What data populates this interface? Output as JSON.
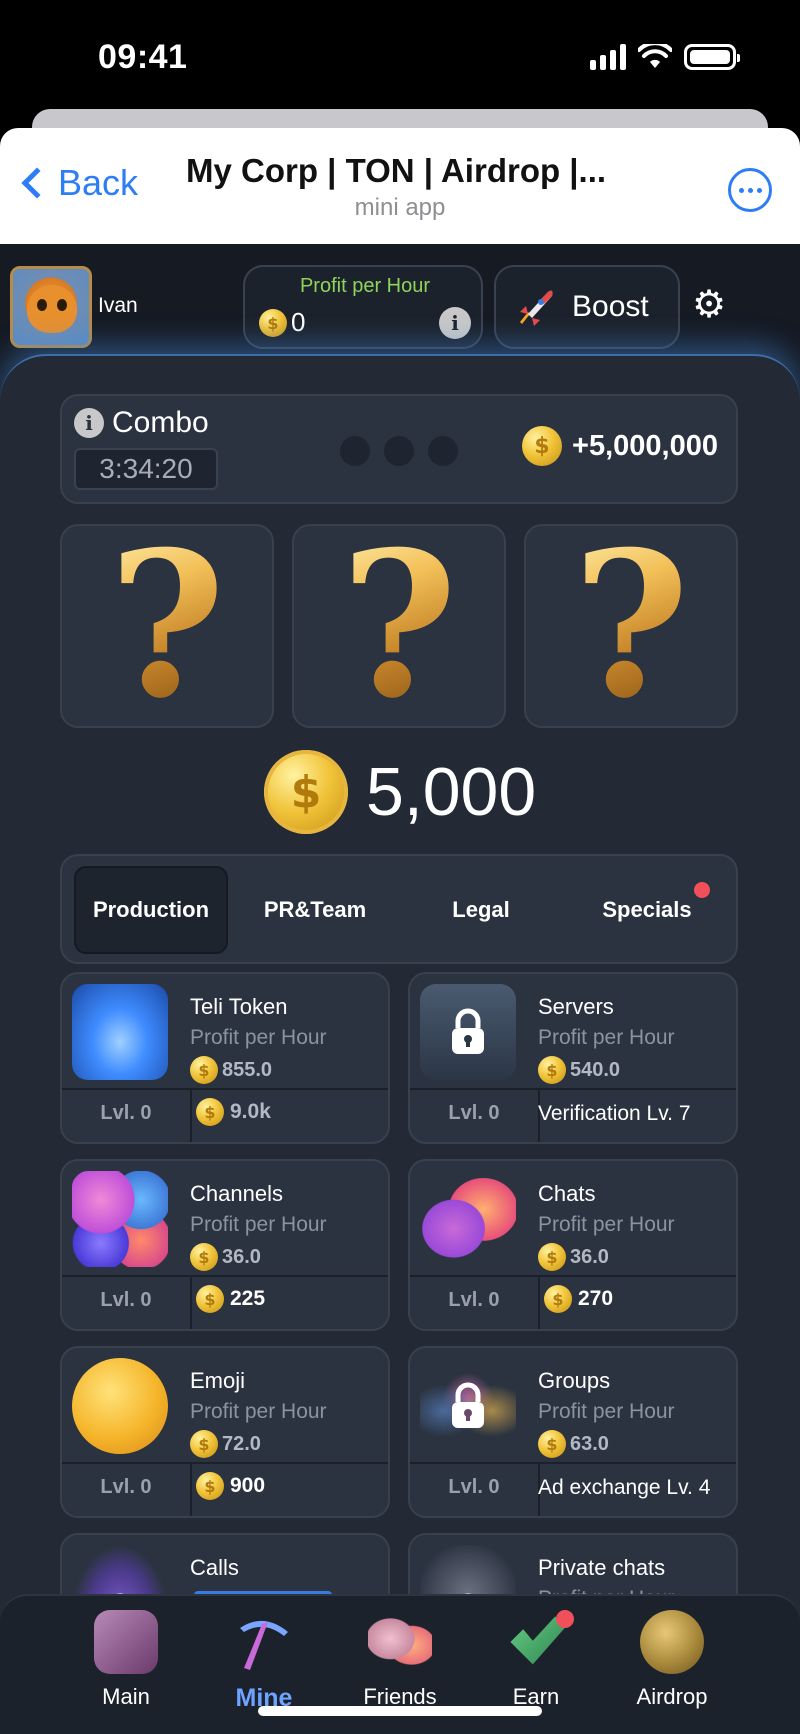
{
  "status_bar": {
    "time": "09:41"
  },
  "header": {
    "back_label": "Back",
    "title": "My Corp | TON | Airdrop |...",
    "subtitle": "mini app"
  },
  "user": {
    "name": "Ivan"
  },
  "profit": {
    "label": "Profit per Hour",
    "value": "0",
    "info": "i"
  },
  "boost": {
    "label": "Boost"
  },
  "combo": {
    "title": "Combo",
    "info": "i",
    "timer": "3:34:20",
    "reward": "+5,000,000"
  },
  "mystery_cards": [
    "?",
    "?",
    "?"
  ],
  "balance": {
    "value": "5,000"
  },
  "tabs": [
    {
      "label": "Production",
      "active": true
    },
    {
      "label": "PR&Team"
    },
    {
      "label": "Legal"
    },
    {
      "label": "Specials",
      "badge": true
    }
  ],
  "items": [
    {
      "name": "Teli Token",
      "sub": "Profit per Hour",
      "profit": "855.0",
      "level": "Lvl. 0",
      "cost": "9.0k",
      "icon": "token-stack-icon",
      "color": "#3f8cff"
    },
    {
      "name": "Servers",
      "sub": "Profit per Hour",
      "profit": "540.0",
      "level": "Lvl. 0",
      "requirement": "Verification Lv. 7",
      "icon": "lock-icon",
      "color": "#3a4456"
    },
    {
      "name": "Channels",
      "sub": "Profit per Hour",
      "profit": "36.0",
      "level": "Lvl. 0",
      "cost": "225",
      "icon": "megaphone-icon",
      "color": "#c04fd8"
    },
    {
      "name": "Chats",
      "sub": "Profit per Hour",
      "profit": "36.0",
      "level": "Lvl. 0",
      "cost": "270",
      "icon": "chat-bubbles-icon",
      "color": "#e06890"
    },
    {
      "name": "Emoji",
      "sub": "Profit per Hour",
      "profit": "72.0",
      "level": "Lvl. 0",
      "cost": "900",
      "icon": "emoji-icon",
      "color": "#f5b52a"
    },
    {
      "name": "Groups",
      "sub": "Profit per Hour",
      "profit": "63.0",
      "level": "Lvl. 0",
      "requirement": "Ad exchange Lv. 4",
      "icon": "lock-icon",
      "color": "#4b5a6e"
    },
    {
      "name": "Calls",
      "icon": "lock-icon",
      "color": "#5a4a8a"
    },
    {
      "name": "Private chats",
      "sub": "Profit per Hour",
      "icon": "lock-icon",
      "color": "#4a5060"
    }
  ],
  "bottom_nav": [
    {
      "label": "Main",
      "icon": "cube-icon",
      "color": "#8a5a8a"
    },
    {
      "label": "Mine",
      "icon": "pickaxe-icon",
      "color": "#5a7ad8",
      "active": true
    },
    {
      "label": "Friends",
      "icon": "ghosts-icon",
      "color": "#d88a9a"
    },
    {
      "label": "Earn",
      "icon": "check-icon",
      "color": "#3a9a5a",
      "badge": true
    },
    {
      "label": "Airdrop",
      "icon": "coin-icon",
      "color": "#a8883a"
    }
  ]
}
